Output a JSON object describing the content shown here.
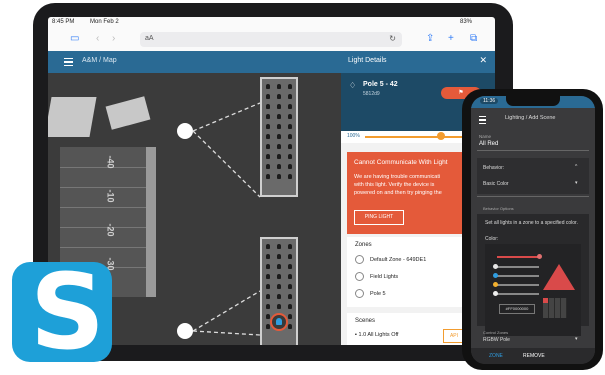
{
  "tablet": {
    "status": {
      "time": "8:45 PM",
      "date": "Mon Feb 2",
      "battery": "83%"
    },
    "browser": {
      "url_label": "aA"
    },
    "app": {
      "breadcrumb": "A&M / Map"
    },
    "map": {
      "yard_lines": [
        "-10",
        "-20",
        "-30",
        "-40"
      ]
    },
    "panel": {
      "title": "Light Details",
      "close": "✕",
      "device_name": "Pole 5 - 42",
      "device_id": "5812d9",
      "brightness_pct": "100%",
      "brightness_suffix": "Bi",
      "alert_title": "Cannot Communicate With Light",
      "alert_message": "We are having trouble communicati\nwith this light. Verify the device is\npowered on and then try pinging the",
      "ping_button": "PING LIGHT",
      "zones_title": "Zones",
      "zones": [
        "Default Zone - 649DE1",
        "Field Lights",
        "Pole 5"
      ],
      "scenes_title": "Scenes",
      "scene_item": "1.0 All Lights Off",
      "apply_button": "API"
    }
  },
  "phone": {
    "status_time": "11:36",
    "breadcrumb": "Lighting / Add Scene",
    "name_label": "Name",
    "name_value": "All Red",
    "behavior_label": "Behavior:",
    "behavior_value": "Basic Color",
    "behavior_options_label": "Behavior Options",
    "options_desc": "Set all lights in a zone to a specified color.",
    "color_label": "Color:",
    "hex_value": "#FF0000000",
    "control_zones_label": "Control Zones",
    "control_zone_value": "RGBW Pole",
    "tab_zone": "ZONE",
    "tab_remove": "REMOVE"
  },
  "colors": {
    "brand_blue": "#2a6a94",
    "alert_red": "#e45a3a",
    "accent_orange": "#f29c2f",
    "logo_blue": "#1ea0d8"
  }
}
